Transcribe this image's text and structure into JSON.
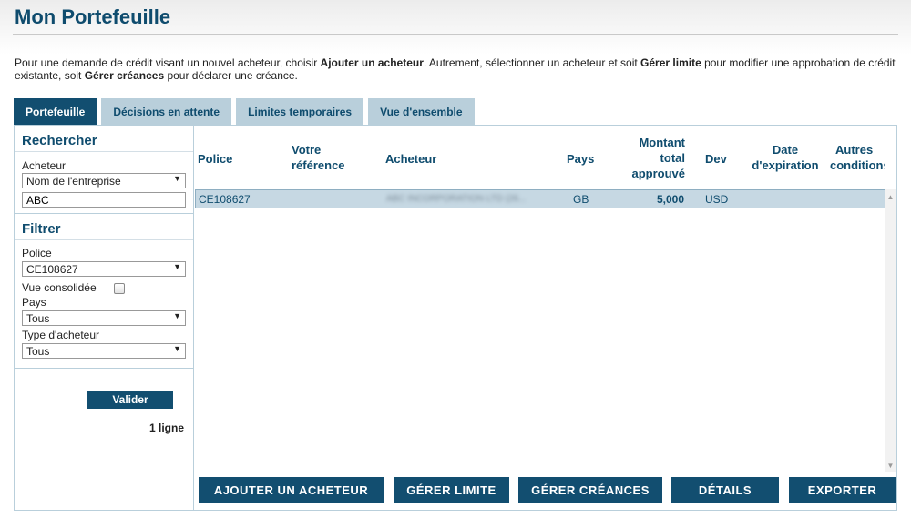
{
  "page": {
    "title": "Mon Portefeuille",
    "intro": {
      "t1": "Pour une demande de crédit visant un nouvel acheteur, choisir ",
      "b1": "Ajouter un acheteur",
      "t2": ". Autrement, sélectionner un acheteur et soit ",
      "b2": "Gérer limite",
      "t3": " pour modifier une approbation de crédit existante, soit ",
      "b3": "Gérer créances",
      "t4": " pour déclarer une créance."
    }
  },
  "tabs": [
    {
      "label": "Portefeuille",
      "active": true
    },
    {
      "label": "Décisions en attente"
    },
    {
      "label": "Limites temporaires"
    },
    {
      "label": "Vue d'ensemble"
    }
  ],
  "search": {
    "heading": "Rechercher",
    "buyer_label": "Acheteur",
    "buyer_field_value": "Nom de l'entreprise",
    "buyer_text": "ABC"
  },
  "filter": {
    "heading": "Filtrer",
    "policy_label": "Police",
    "policy_value": "CE108627",
    "consolidated_label": "Vue consolidée",
    "consolidated_checked": false,
    "country_label": "Pays",
    "country_value": "Tous",
    "buyer_type_label": "Type d'acheteur",
    "buyer_type_value": "Tous",
    "submit_label": "Valider",
    "count_text": "1 ligne"
  },
  "table": {
    "columns": {
      "police": "Police",
      "ref_1": "Votre",
      "ref_2": "référence",
      "buyer": "Acheteur",
      "country": "Pays",
      "amount_1": "Montant",
      "amount_2": "total",
      "amount_3": "approuvé",
      "currency": "Dev",
      "exp_1": "Date",
      "exp_2": "d'expiration",
      "cond_1": "Autres",
      "cond_2": "conditions"
    },
    "rows": [
      {
        "police": "CE108627",
        "reference": "",
        "buyer": "ABC INCORPORATION LTD (26...",
        "country": "GB",
        "amount": "5,000",
        "currency": "USD",
        "expiration": "",
        "conditions": ""
      }
    ]
  },
  "actions": {
    "add_buyer": "AJOUTER UN ACHETEUR",
    "manage_limit": "GÉRER LIMITE",
    "manage_claims": "GÉRER CRÉANCES",
    "details": "DÉTAILS",
    "export": "EXPORTER"
  },
  "icons": {
    "dropdown": "triangle-down",
    "scroll_up": "triangle-up",
    "scroll_down": "triangle-down"
  },
  "colors": {
    "brand": "#124e70",
    "tab_inactive": "#b9cfdb",
    "row_selected": "#c6d8e3"
  }
}
